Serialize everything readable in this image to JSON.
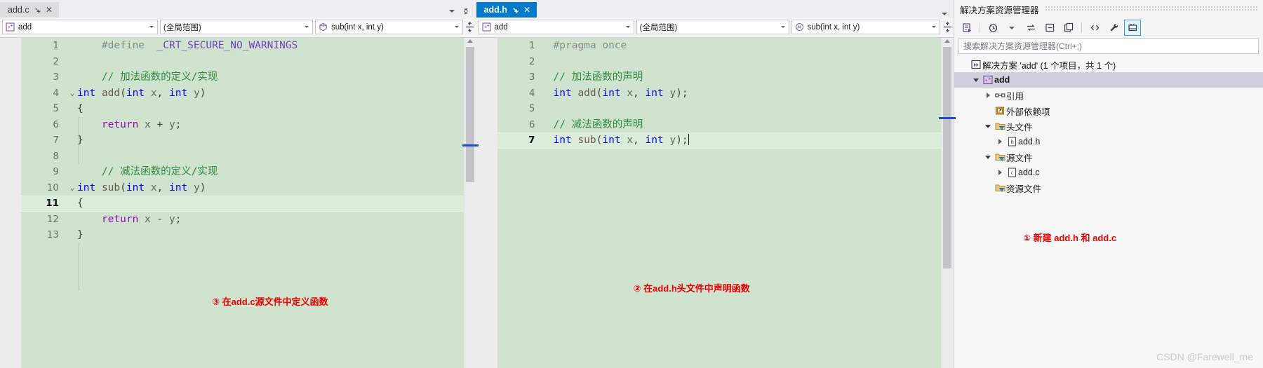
{
  "app": {
    "ide": "Visual Studio",
    "watermark": "CSDN @Farewell_me",
    "accent_blue": "#007acc",
    "editor_bg": "#cfe3cf",
    "annotation_color": "#ef0000"
  },
  "left_pane": {
    "tab": {
      "label": "add.c",
      "active": false,
      "pin_icon": "pin-icon",
      "close_icon": "close-icon"
    },
    "tabstrip_buttons": {
      "dropdown_icon": "chevron-down-icon",
      "settings_icon": "gear-icon"
    },
    "navbar": {
      "project": {
        "value": "add",
        "icon": "project-icon"
      },
      "scope": {
        "value": "(全局范围)"
      },
      "member": {
        "value": "sub(int x, int y)",
        "icon": "function-icon"
      },
      "split_icon": "split-window-icon"
    },
    "scrollbar": {
      "up_arrow_icon": "scroll-up-arrow-icon"
    },
    "annotation": "③ 在add.c源文件中定义函数",
    "lines": [
      {
        "n": "1",
        "fold": "",
        "tokens": [
          {
            "t": "    ",
            "c": "k-pun"
          },
          {
            "t": "#define",
            "c": "k-pre"
          },
          {
            "t": "  ",
            "c": "k-pun"
          },
          {
            "t": "_CRT_SECURE_NO_WARNINGS",
            "c": "k-macro"
          }
        ]
      },
      {
        "n": "2",
        "fold": "",
        "tokens": []
      },
      {
        "n": "3",
        "fold": "",
        "tokens": [
          {
            "t": "    ",
            "c": "k-pun"
          },
          {
            "t": "// 加法函数的定义/实现",
            "c": "k-cmt"
          }
        ]
      },
      {
        "n": "4",
        "fold": "v",
        "tokens": [
          {
            "t": "int",
            "c": "k-kw"
          },
          {
            "t": " ",
            "c": "k-pun"
          },
          {
            "t": "add",
            "c": "k-fn"
          },
          {
            "t": "(",
            "c": "k-pun"
          },
          {
            "t": "int",
            "c": "k-kw"
          },
          {
            "t": " ",
            "c": "k-pun"
          },
          {
            "t": "x",
            "c": "k-var"
          },
          {
            "t": ", ",
            "c": "k-pun"
          },
          {
            "t": "int",
            "c": "k-kw"
          },
          {
            "t": " ",
            "c": "k-pun"
          },
          {
            "t": "y",
            "c": "k-var"
          },
          {
            "t": ")",
            "c": "k-pun"
          }
        ]
      },
      {
        "n": "5",
        "fold": "",
        "tokens": [
          {
            "t": "{",
            "c": "k-pun"
          }
        ]
      },
      {
        "n": "6",
        "fold": "",
        "tokens": [
          {
            "t": "    ",
            "c": "k-pun"
          },
          {
            "t": "return",
            "c": "k-kw2"
          },
          {
            "t": " ",
            "c": "k-pun"
          },
          {
            "t": "x",
            "c": "k-var"
          },
          {
            "t": " + ",
            "c": "k-pun"
          },
          {
            "t": "y",
            "c": "k-var"
          },
          {
            "t": ";",
            "c": "k-pun"
          }
        ]
      },
      {
        "n": "7",
        "fold": "",
        "tokens": [
          {
            "t": "}",
            "c": "k-pun"
          }
        ]
      },
      {
        "n": "8",
        "fold": "",
        "tokens": []
      },
      {
        "n": "9",
        "fold": "",
        "tokens": [
          {
            "t": "    ",
            "c": "k-pun"
          },
          {
            "t": "// 减法函数的定义/实现",
            "c": "k-cmt"
          }
        ]
      },
      {
        "n": "10",
        "fold": "v",
        "tokens": [
          {
            "t": "int",
            "c": "k-kw"
          },
          {
            "t": " ",
            "c": "k-pun"
          },
          {
            "t": "sub",
            "c": "k-fn"
          },
          {
            "t": "(",
            "c": "k-pun"
          },
          {
            "t": "int",
            "c": "k-kw"
          },
          {
            "t": " ",
            "c": "k-pun"
          },
          {
            "t": "x",
            "c": "k-var"
          },
          {
            "t": ", ",
            "c": "k-pun"
          },
          {
            "t": "int",
            "c": "k-kw"
          },
          {
            "t": " ",
            "c": "k-pun"
          },
          {
            "t": "y",
            "c": "k-var"
          },
          {
            "t": ")",
            "c": "k-pun"
          }
        ]
      },
      {
        "n": "11",
        "fold": "",
        "current": true,
        "tokens": [
          {
            "t": "{",
            "c": "k-pun"
          }
        ]
      },
      {
        "n": "12",
        "fold": "",
        "tokens": [
          {
            "t": "    ",
            "c": "k-pun"
          },
          {
            "t": "return",
            "c": "k-kw2"
          },
          {
            "t": " ",
            "c": "k-pun"
          },
          {
            "t": "x",
            "c": "k-var"
          },
          {
            "t": " - ",
            "c": "k-pun"
          },
          {
            "t": "y",
            "c": "k-var"
          },
          {
            "t": ";",
            "c": "k-pun"
          }
        ]
      },
      {
        "n": "13",
        "fold": "",
        "tokens": [
          {
            "t": "}",
            "c": "k-pun"
          }
        ]
      }
    ]
  },
  "right_pane": {
    "tab": {
      "label": "add.h",
      "active": true,
      "pin_icon": "pin-icon",
      "close_icon": "close-icon"
    },
    "tabstrip_buttons": {
      "dropdown_icon": "chevron-down-icon"
    },
    "navbar": {
      "project": {
        "value": "add",
        "icon": "project-icon"
      },
      "scope": {
        "value": "(全局范围)"
      },
      "member": {
        "value": "sub(int x, int y)",
        "icon": "function-icon"
      },
      "split_icon": "split-window-icon"
    },
    "scrollbar": {
      "up_arrow_icon": "scroll-up-arrow-icon"
    },
    "annotation": "② 在add.h头文件中声明函数",
    "lines": [
      {
        "n": "1",
        "fold": "",
        "tokens": [
          {
            "t": "#pragma",
            "c": "k-pre"
          },
          {
            "t": " ",
            "c": "k-pun"
          },
          {
            "t": "once",
            "c": "k-pre"
          }
        ]
      },
      {
        "n": "2",
        "fold": "",
        "tokens": []
      },
      {
        "n": "3",
        "fold": "",
        "tokens": [
          {
            "t": "// 加法函数的声明",
            "c": "k-cmt"
          }
        ]
      },
      {
        "n": "4",
        "fold": "",
        "tokens": [
          {
            "t": "int",
            "c": "k-kw"
          },
          {
            "t": " ",
            "c": "k-pun"
          },
          {
            "t": "add",
            "c": "k-fn"
          },
          {
            "t": "(",
            "c": "k-pun"
          },
          {
            "t": "int",
            "c": "k-kw"
          },
          {
            "t": " ",
            "c": "k-pun"
          },
          {
            "t": "x",
            "c": "k-var"
          },
          {
            "t": ", ",
            "c": "k-pun"
          },
          {
            "t": "int",
            "c": "k-kw"
          },
          {
            "t": " ",
            "c": "k-pun"
          },
          {
            "t": "y",
            "c": "k-var"
          },
          {
            "t": ");",
            "c": "k-pun"
          }
        ]
      },
      {
        "n": "5",
        "fold": "",
        "tokens": []
      },
      {
        "n": "6",
        "fold": "",
        "tokens": [
          {
            "t": "// 减法函数的声明",
            "c": "k-cmt"
          }
        ]
      },
      {
        "n": "7",
        "fold": "",
        "current": true,
        "caret": true,
        "tokens": [
          {
            "t": "int",
            "c": "k-kw"
          },
          {
            "t": " ",
            "c": "k-pun"
          },
          {
            "t": "sub",
            "c": "k-fn"
          },
          {
            "t": "(",
            "c": "k-pun"
          },
          {
            "t": "int",
            "c": "k-kw"
          },
          {
            "t": " ",
            "c": "k-pun"
          },
          {
            "t": "x",
            "c": "k-var"
          },
          {
            "t": ", ",
            "c": "k-pun"
          },
          {
            "t": "int",
            "c": "k-kw"
          },
          {
            "t": " ",
            "c": "k-pun"
          },
          {
            "t": "y",
            "c": "k-var"
          },
          {
            "t": ");",
            "c": "k-pun"
          }
        ]
      }
    ]
  },
  "solution_explorer": {
    "title": "解决方案资源管理器",
    "search_placeholder": "搜索解决方案资源管理器(Ctrl+;)",
    "toolbar": [
      {
        "name": "home-view-icon"
      },
      {
        "name": "history-icon"
      },
      {
        "name": "history-dropdown-icon"
      },
      {
        "name": "sync-with-active-document-icon"
      },
      {
        "name": "collapse-all-icon"
      },
      {
        "name": "show-all-files-icon"
      },
      {
        "name": "code-view-icon"
      },
      {
        "name": "properties-wrench-icon"
      },
      {
        "name": "preview-selected-items-icon"
      }
    ],
    "annotation": "① 新建 add.h 和 add.c",
    "tree": [
      {
        "label": "解决方案 'add' (1 个项目，共 1 个)",
        "indent": 0,
        "expander": "none",
        "icon": "solution-icon",
        "selected": false,
        "bold": false
      },
      {
        "label": "add",
        "indent": 1,
        "expander": "down",
        "icon": "cpp-project-icon",
        "selected": true,
        "bold": true
      },
      {
        "label": "引用",
        "indent": 2,
        "expander": "right",
        "icon": "references-icon",
        "selected": false,
        "bold": false
      },
      {
        "label": "外部依赖项",
        "indent": 2,
        "expander": "none",
        "icon": "external-deps-icon",
        "selected": false,
        "bold": false
      },
      {
        "label": "头文件",
        "indent": 2,
        "expander": "down",
        "icon": "filter-folder-icon",
        "selected": false,
        "bold": false
      },
      {
        "label": "add.h",
        "indent": 3,
        "expander": "right",
        "icon": "header-file-icon",
        "selected": false,
        "bold": false
      },
      {
        "label": "源文件",
        "indent": 2,
        "expander": "down",
        "icon": "filter-folder-icon",
        "selected": false,
        "bold": false
      },
      {
        "label": "add.c",
        "indent": 3,
        "expander": "right",
        "icon": "c-file-icon",
        "selected": false,
        "bold": false
      },
      {
        "label": "资源文件",
        "indent": 2,
        "expander": "none",
        "icon": "filter-folder-icon",
        "selected": false,
        "bold": false
      }
    ]
  }
}
